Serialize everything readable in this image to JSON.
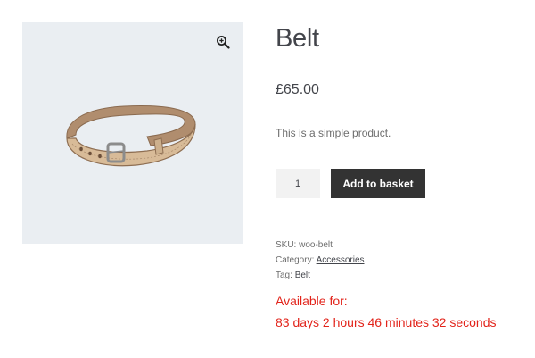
{
  "product": {
    "title": "Belt",
    "price": "£65.00",
    "description": "This is a simple product.",
    "image_icon": "belt-image",
    "zoom_icon": "magnifier-plus-icon"
  },
  "cart": {
    "quantity": "1",
    "add_button_label": "Add to basket",
    "button_color": "#333333"
  },
  "meta": {
    "sku_label": "SKU:",
    "sku_value": "woo-belt",
    "category_label": "Category:",
    "category_value": "Accessories",
    "tag_label": "Tag:",
    "tag_value": "Belt"
  },
  "availability": {
    "label": "Available for:",
    "countdown": "83 days 2 hours 46 minutes 32 seconds",
    "color": "#e2231a"
  }
}
